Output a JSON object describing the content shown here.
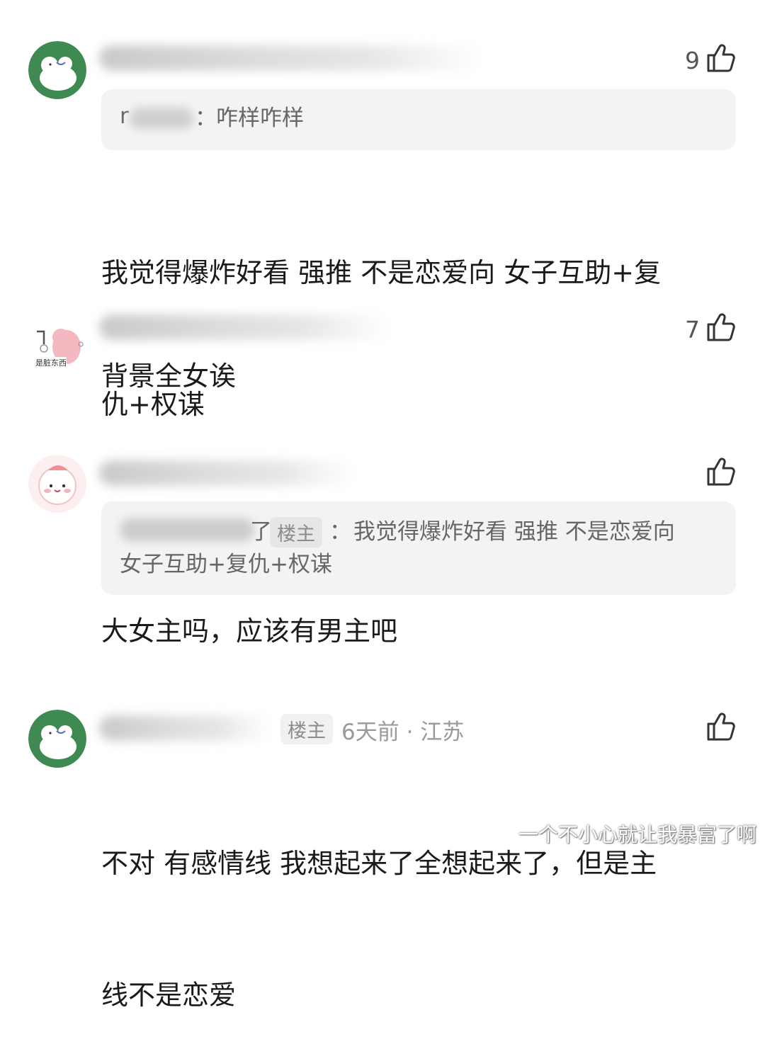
{
  "comments": [
    {
      "like_count": "9",
      "quote_author_visible": "r",
      "quote_sep": "：",
      "quote_text": "咋样咋样",
      "body": "我觉得爆炸好看 强推 不是恋爱向 女子互助+复仇+权谋",
      "body_lines": [
        "我觉得爆炸好看 强推 不是恋爱向 女子互助+复",
        "仇+权谋"
      ]
    },
    {
      "like_count": "7",
      "avatar_caption": "是脏东西",
      "body": "背景全女诶"
    },
    {
      "like_count": "",
      "quote_name_tail": "了",
      "quote_badge": "楼主",
      "quote_sep": "：",
      "quote_text_line1": "我觉得爆炸好看 强推 不是恋爱向",
      "quote_text_line2": "女子互助+复仇+权谋",
      "body": "大女主吗，应该有男主吧"
    },
    {
      "like_count": "",
      "op_badge": "楼主",
      "meta": "6天前 · 江苏",
      "body_lines": [
        "不对 有感情线 我想起来了全想起来了，但是主",
        "线不是恋爱"
      ]
    }
  ],
  "watermark": "一个不小心就让我暴富了啊",
  "icons": {
    "like": "thumbs-up-icon"
  },
  "colors": {
    "quote_bg": "#f3f3f3",
    "meta_gray": "#9a9a9a",
    "avatar_green": "#3e8a52"
  }
}
